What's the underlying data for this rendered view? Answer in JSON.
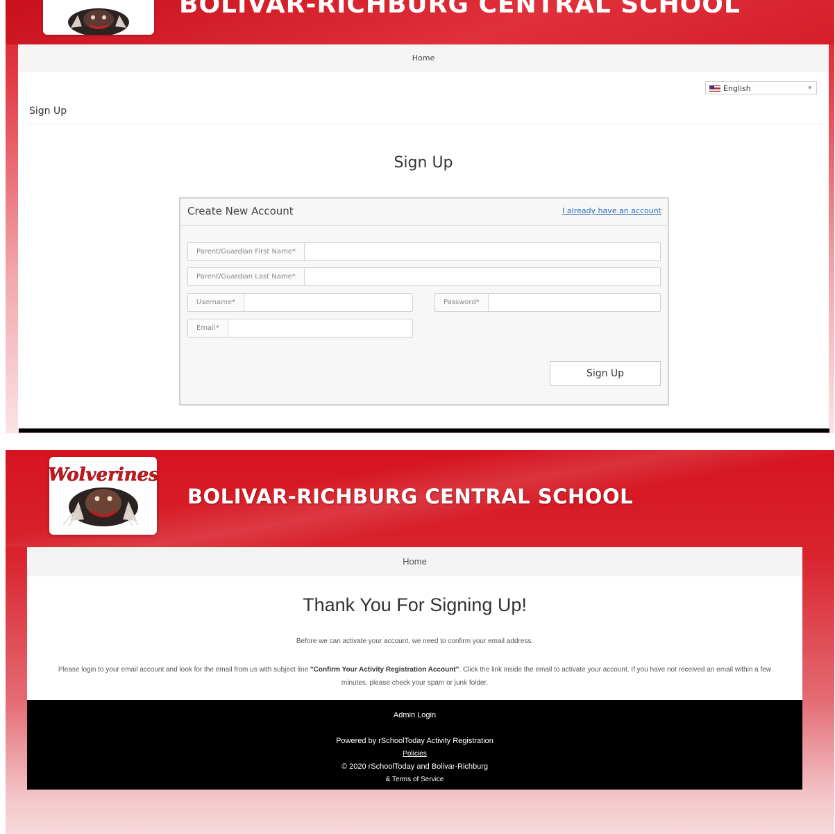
{
  "colors": {
    "brand_red": "#d71f2b",
    "link_blue": "#2a6ebb",
    "footer_black": "#000000"
  },
  "top": {
    "header": {
      "school_name": "BOLIVAR-RICHBURG CENTRAL SCHOOL",
      "logo_icon": "wolverine-logo"
    },
    "nav": {
      "home": "Home"
    },
    "language": {
      "flag_icon": "us-flag-icon",
      "selected": "English"
    },
    "breadcrumb": "Sign Up",
    "page_title": "Sign Up",
    "card": {
      "title": "Create New Account",
      "existing_account_link": "I already have an account",
      "fields": {
        "first_name": "Parent/Guardian First Name*",
        "last_name": "Parent/Guardian Last Name*",
        "username": "Username*",
        "password": "Password*",
        "email": "Email*"
      },
      "submit": "Sign Up"
    }
  },
  "bottom": {
    "header": {
      "school_name": "BOLIVAR-RICHBURG CENTRAL SCHOOL",
      "logo_text": "Wolverines"
    },
    "nav": {
      "home": "Home"
    },
    "title": "Thank You For Signing Up!",
    "intro": "Before we can activate your account, we need to confirm your email address.",
    "instructions_before": "Please login to your email account and look for the email from us with subject line ",
    "instructions_subject": "\"Confirm Your Activity Registration Account\"",
    "instructions_after": ". Click the link inside the email to activate your account. If you have not received an email within a few minutes, please check your spam or junk folder.",
    "footer": {
      "admin_login": "Admin Login",
      "powered_by": "Powered by rSchoolToday Activity Registration",
      "policies": "Policies",
      "copyright": "© 2020 rSchoolToday and Bolivar-Richburg",
      "terms": "& Terms of Service"
    }
  }
}
